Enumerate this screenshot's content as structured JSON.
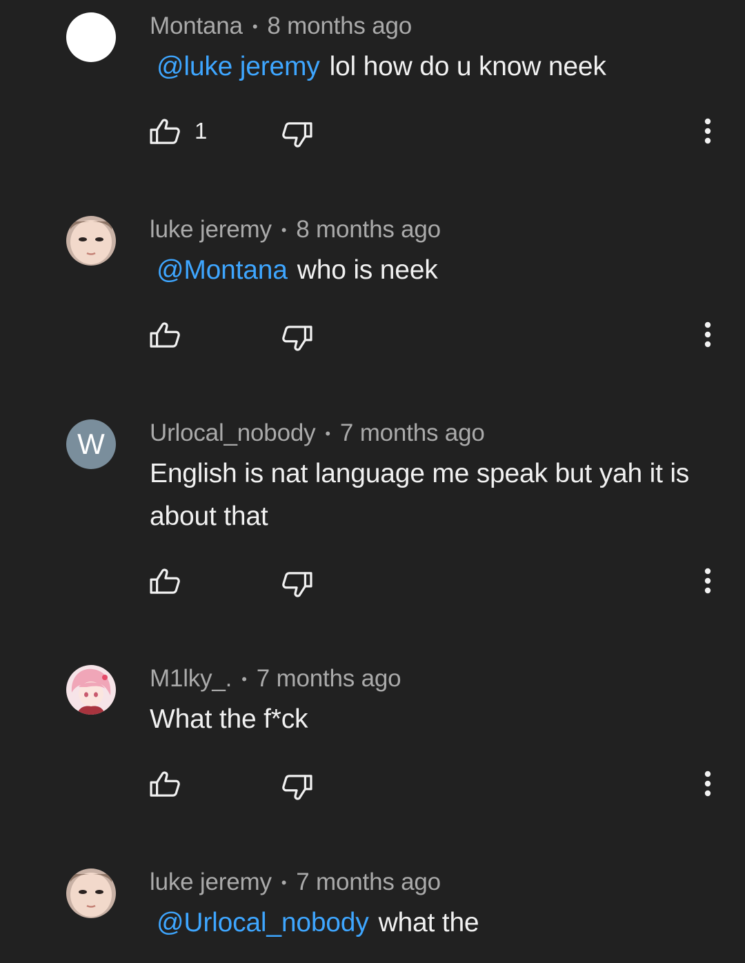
{
  "comments": [
    {
      "author": "Montana",
      "separator": "•",
      "time": "8 months ago",
      "mention": "@luke jeremy",
      "text": "lol how do u know neek",
      "likes": "1",
      "avatar": "white-circle"
    },
    {
      "author": "luke jeremy",
      "separator": "•",
      "time": "8 months ago",
      "mention": "@Montana",
      "text": "who is neek",
      "likes": "",
      "avatar": "face-photo"
    },
    {
      "author": "Urlocal_nobody",
      "separator": "•",
      "time": "7 months ago",
      "mention": "",
      "text": "English is nat language me speak but yah it is about that",
      "likes": "",
      "avatar_letter": "W",
      "avatar_color": "#7a8e9c"
    },
    {
      "author": "M1lky_.",
      "separator": "•",
      "time": "7 months ago",
      "mention": "",
      "text": "What the f*ck",
      "likes": "",
      "avatar": "anime-girl"
    },
    {
      "author": "luke jeremy",
      "separator": "•",
      "time": "7 months ago",
      "mention": "@Urlocal_nobody",
      "text": "what the",
      "likes": "",
      "avatar": "face-photo"
    }
  ],
  "icons": {
    "like": "thumbs-up-icon",
    "dislike": "thumbs-down-icon",
    "more": "more-vertical-icon"
  },
  "colors": {
    "background": "#212121",
    "mention": "#3ea6ff",
    "meta": "#aaaaaa",
    "text": "#f1f1f1"
  }
}
